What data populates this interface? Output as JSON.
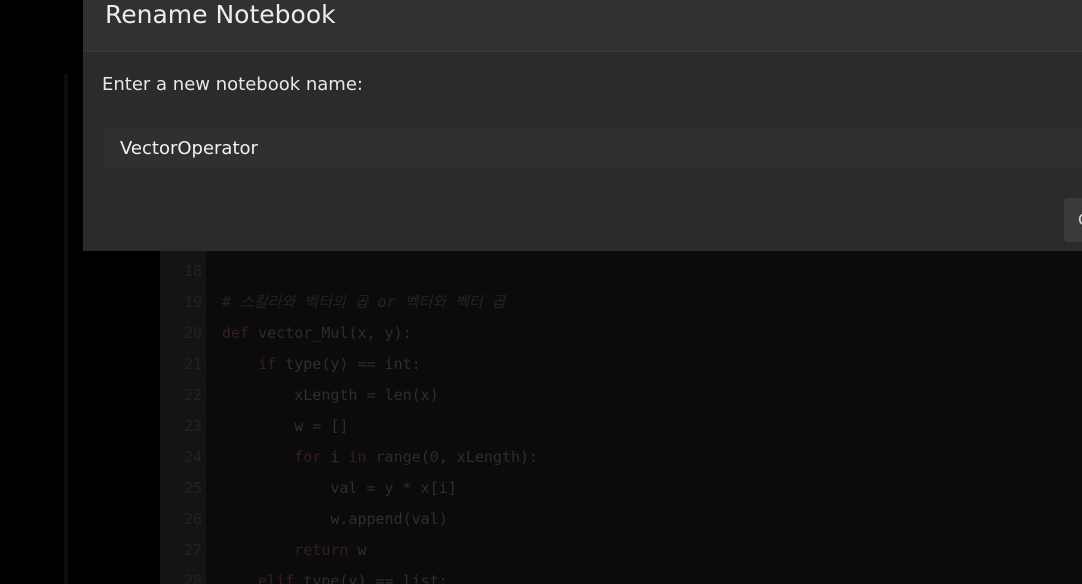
{
  "dialog": {
    "title": "Rename Notebook",
    "prompt_label": "Enter a new notebook name:",
    "name_value": "VectorOperator",
    "button_label": "C"
  },
  "editor": {
    "lines": [
      {
        "num": "18",
        "parts": []
      },
      {
        "num": "19",
        "parts": [
          {
            "t": "comment",
            "v": "# 스칼라와 벡터의 곱 or 벡터와 벡터 곱"
          }
        ]
      },
      {
        "num": "20",
        "parts": [
          {
            "t": "kw",
            "v": "def "
          },
          {
            "t": "fn",
            "v": "vector_Mul"
          },
          {
            "t": "plain",
            "v": "(x, y):"
          }
        ]
      },
      {
        "num": "21",
        "parts": [
          {
            "t": "plain",
            "v": "    "
          },
          {
            "t": "kw",
            "v": "if "
          },
          {
            "t": "plain",
            "v": "type(y) == int:"
          }
        ]
      },
      {
        "num": "22",
        "parts": [
          {
            "t": "plain",
            "v": "        xLength = "
          },
          {
            "t": "fn",
            "v": "len"
          },
          {
            "t": "plain",
            "v": "(x)"
          }
        ]
      },
      {
        "num": "23",
        "parts": [
          {
            "t": "plain",
            "v": "        w = []"
          }
        ]
      },
      {
        "num": "24",
        "parts": [
          {
            "t": "plain",
            "v": "        "
          },
          {
            "t": "kw",
            "v": "for "
          },
          {
            "t": "plain",
            "v": "i "
          },
          {
            "t": "kw",
            "v": "in "
          },
          {
            "t": "fn",
            "v": "range"
          },
          {
            "t": "plain",
            "v": "("
          },
          {
            "t": "num",
            "v": "0"
          },
          {
            "t": "plain",
            "v": ", xLength):"
          }
        ]
      },
      {
        "num": "25",
        "parts": [
          {
            "t": "plain",
            "v": "            val = y * x[i]"
          }
        ]
      },
      {
        "num": "26",
        "parts": [
          {
            "t": "plain",
            "v": "            w.append(val)"
          }
        ]
      },
      {
        "num": "27",
        "parts": [
          {
            "t": "plain",
            "v": "        "
          },
          {
            "t": "kw",
            "v": "return "
          },
          {
            "t": "plain",
            "v": "w"
          }
        ]
      },
      {
        "num": "28",
        "parts": [
          {
            "t": "plain",
            "v": "    "
          },
          {
            "t": "kw",
            "v": "elif "
          },
          {
            "t": "plain",
            "v": "type(y) == list:"
          }
        ]
      }
    ]
  }
}
